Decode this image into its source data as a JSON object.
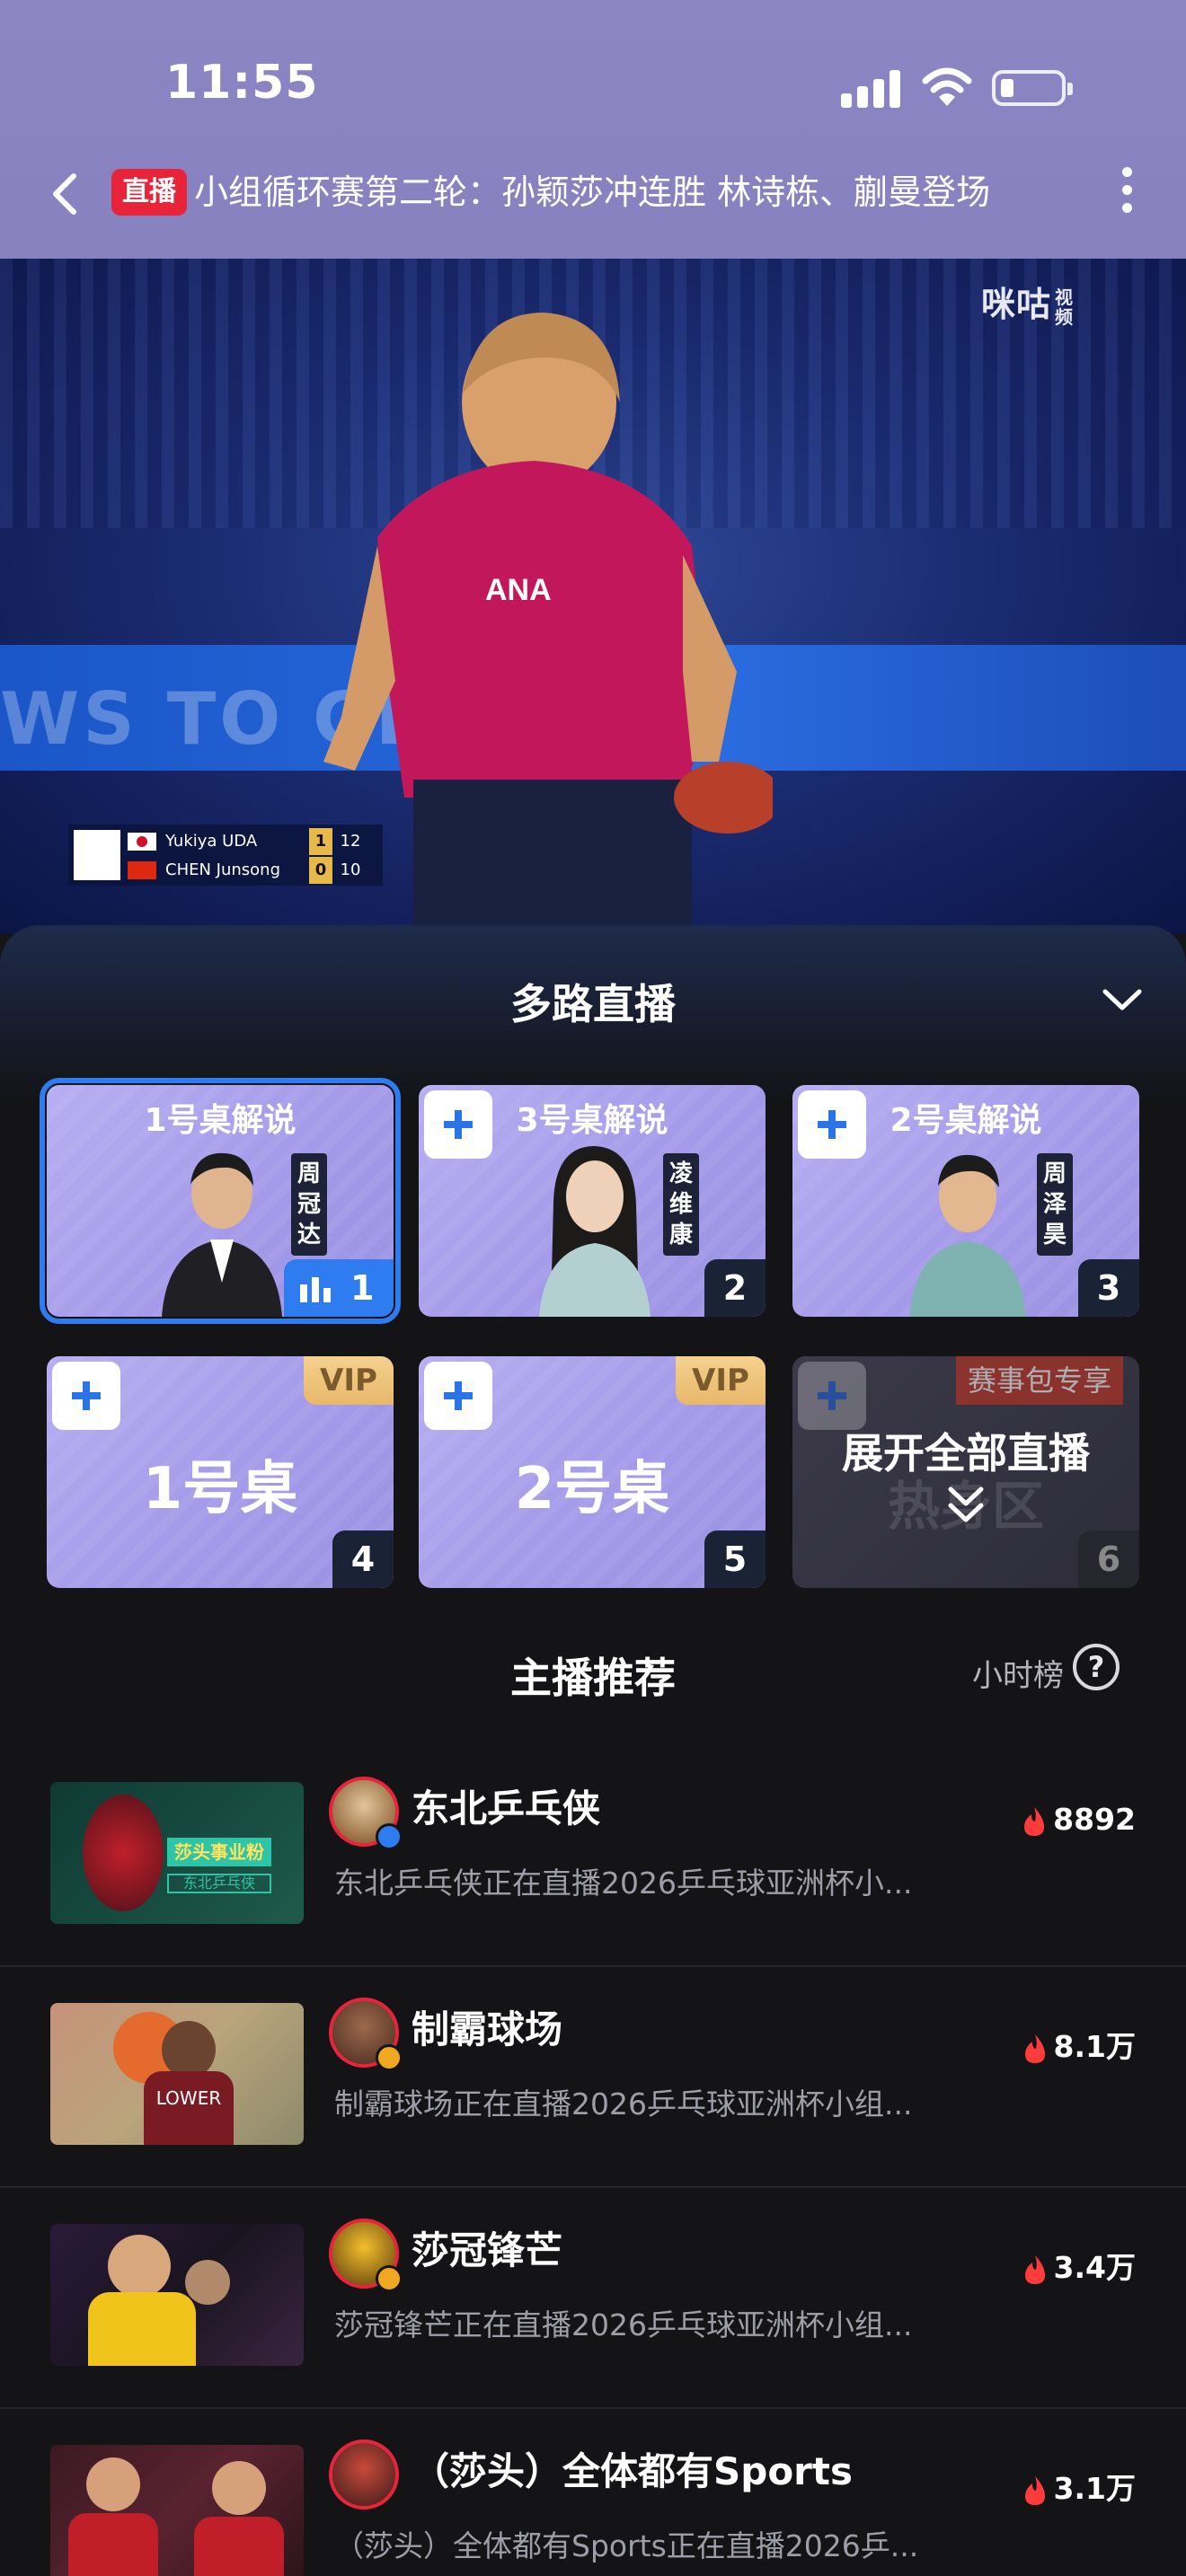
{
  "status_bar": {
    "time": "11:55"
  },
  "header": {
    "live_badge": "直播",
    "title": "小组循环赛第二轮：孙颖莎冲连胜 林诗栋、蒯曼登场"
  },
  "video": {
    "watermark": "咪咕",
    "watermark_sub": "视频",
    "banner_text": "WS TO GLOBE",
    "scoreboard": [
      {
        "name": "Yukiya UDA",
        "games": "1",
        "points": "12"
      },
      {
        "name": "CHEN Junsong",
        "games": "0",
        "points": "10"
      }
    ]
  },
  "multi_live": {
    "title": "多路直播",
    "tiles": [
      {
        "name": "1号桌解说",
        "commentator": "周冠达",
        "number": "1",
        "selected": true
      },
      {
        "name": "3号桌解说",
        "commentator": "凌维康",
        "number": "2"
      },
      {
        "name": "2号桌解说",
        "commentator": "周泽昊",
        "number": "3"
      },
      {
        "name": "1号桌",
        "badge": "VIP",
        "number": "4"
      },
      {
        "name": "2号桌",
        "badge": "VIP",
        "number": "5"
      },
      {
        "name": "热身区",
        "event_badge": "赛事包专享",
        "overlay": "展开全部直播",
        "number": "6"
      }
    ]
  },
  "recommend": {
    "title": "主播推荐",
    "rank_label": "小时榜",
    "help": "?",
    "items": [
      {
        "name": "东北乒乓侠",
        "desc": "东北乒乓侠正在直播2026乒乓球亚洲杯小...",
        "heat": "8892",
        "verified": "blue",
        "thumb_text": "莎头事业粉",
        "thumb_sub": "东北乒乓侠"
      },
      {
        "name": "制霸球场",
        "desc": "制霸球场正在直播2026乒乓球亚洲杯小组...",
        "heat": "8.1万",
        "verified": "gold",
        "thumb_text": "LOWER"
      },
      {
        "name": "莎冠锋芒",
        "desc": "莎冠锋芒正在直播2026乒乓球亚洲杯小组...",
        "heat": "3.4万",
        "verified": "gold"
      },
      {
        "name": "（莎头）全体都有Sports",
        "desc": "（莎头）全体都有Sports正在直播2026乒...",
        "heat": "3.1万",
        "verified": "none"
      }
    ]
  },
  "colors": {
    "accent": "#2f7bf0",
    "live_red": "#e8243b",
    "header_bg": "#8c86c4",
    "tile_bg": "#a9a0ec"
  }
}
